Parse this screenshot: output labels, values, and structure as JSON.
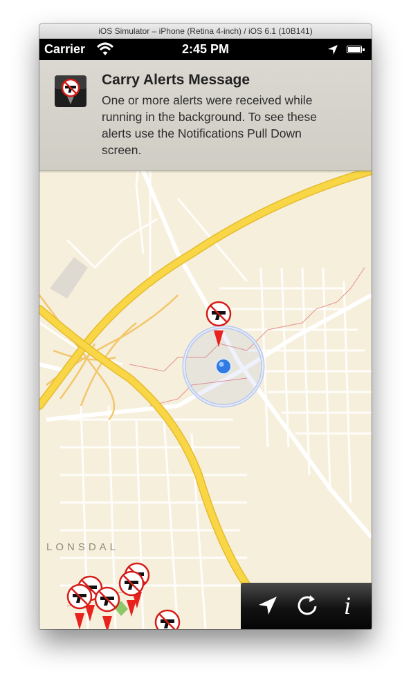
{
  "window": {
    "title": "iOS Simulator – iPhone (Retina 4-inch) / iOS 6.1 (10B141)"
  },
  "status_bar": {
    "carrier": "Carrier",
    "time": "2:45 PM"
  },
  "alert": {
    "title": "Carry Alerts Message",
    "body_lines": [
      "One or more alerts were received while",
      "running in the background.  To see these",
      "alerts use the Notifications Pull Down",
      "screen."
    ]
  },
  "map": {
    "place_label": "LONSDAL"
  },
  "toolbar": {
    "info_label": "i"
  },
  "colors": {
    "map_bg": "#f6efdb",
    "highway": "#f7d23a",
    "pin": "#e8231e",
    "user_dot": "#2f7be3"
  }
}
